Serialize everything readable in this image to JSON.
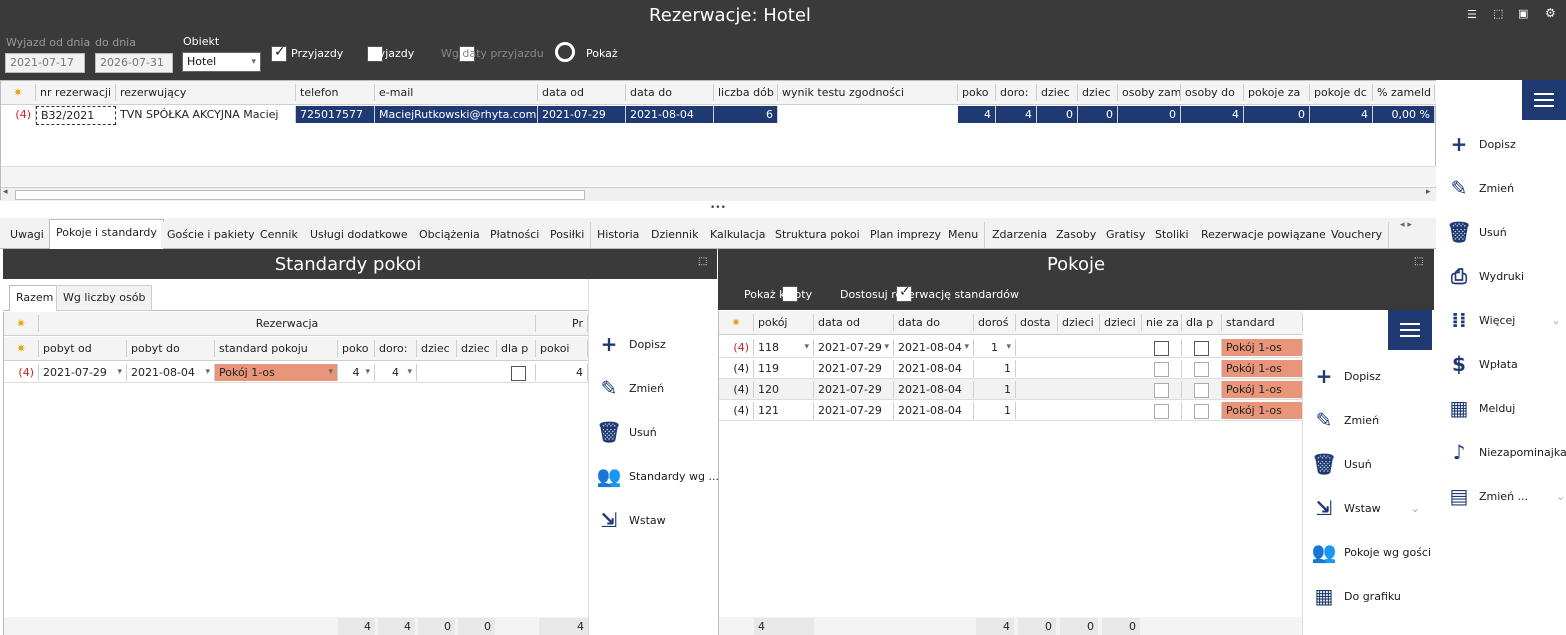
{
  "window": {
    "title": "Rezerwacje: Hotel"
  },
  "top_icons": [
    "list-icon",
    "select-cursor-icon",
    "layout-icon",
    "settings-icon"
  ],
  "filters": {
    "wyjazd_od_label": "Wyjazd od dnia",
    "wyjazd_od_value": "2021-07-17",
    "do_dnia_label": "do dnia",
    "do_dnia_value": "2026-07-31",
    "obiekt_label": "Obiekt",
    "obiekt_value": "Hotel",
    "przyjazdy_label": "Przyjazdy",
    "wyjazdy_label": "Wyjazdy",
    "wg_daty_label": "Wg daty przyjazdu",
    "pokaz_label": "Pokaż"
  },
  "main_table": {
    "columns": [
      "nr rezerwacji",
      "rezerwujący",
      "telefon",
      "e-mail",
      "data od",
      "data do",
      "liczba dób",
      "wynik testu zgodności",
      "poko",
      "doro:",
      "dziec",
      "dziec",
      "osoby zam",
      "osoby do",
      "pokoje za",
      "pokoje dc",
      "% zameld"
    ],
    "row": {
      "count": "(4)",
      "nr": "B32/2021",
      "rezerwujacy": "TVN SPÓŁKA AKCYJNA Maciej",
      "telefon": "725017577",
      "email": "MaciejRutkowski@rhyta.com",
      "data_od": "2021-07-29",
      "data_do": "2021-08-04",
      "doby": "6",
      "wynik": "",
      "pokoje": "4",
      "dorosli": "4",
      "dzieci1": "0",
      "dzieci2": "0",
      "osoby_zam": "0",
      "osoby_do": "4",
      "pokoje_za": "0",
      "pokoje_dc": "4",
      "zameld": "0,00 %"
    }
  },
  "right_sidebar": {
    "actions": [
      "Dopisz",
      "Zmień",
      "Usuń",
      "Wydruki",
      "Więcej",
      "Wpłata",
      "Melduj",
      "Niezapominajka",
      "Zmień ..."
    ]
  },
  "tabs": [
    "Uwagi",
    "Pokoje i standardy",
    "Goście i pakiety",
    "Cennik",
    "Usługi dodatkowe",
    "Obciążenia",
    "Płatności",
    "Posiłki",
    "Historia",
    "Dziennik",
    "Kalkulacja",
    "Struktura pokoi",
    "Plan imprezy",
    "Menu",
    "Zdarzenia",
    "Zasoby",
    "Gratisy",
    "Stoliki",
    "Rezerwacje powiązane",
    "Vouchery"
  ],
  "standardy": {
    "title": "Standardy pokoi",
    "subtabs": [
      "Razem",
      "Wg liczby osób"
    ],
    "group_header": "Rezerwacja",
    "group_header2": "Pr",
    "columns": [
      "pobyt od",
      "pobyt do",
      "standard pokoju",
      "poko",
      "doro:",
      "dziec",
      "dziec",
      "dla p",
      "pokoi"
    ],
    "row": {
      "count": "(4)",
      "od": "2021-07-29",
      "do": "2021-08-04",
      "standard": "Pokój 1-os",
      "pokoje": "4",
      "dorosli": "4",
      "pokoi": "4"
    },
    "sums": [
      "4",
      "4",
      "0",
      "0",
      "4"
    ],
    "actions": [
      "Dopisz",
      "Zmień",
      "Usuń",
      "Standardy wg ...",
      "Wstaw"
    ]
  },
  "pokoje": {
    "title": "Pokoje",
    "pokaz_kwoty": "Pokaż kwoty",
    "dostosuj": "Dostosuj rezerwację standardów",
    "columns": [
      "pokój",
      "data od",
      "data do",
      "doroś",
      "dosta",
      "dzieci",
      "dzieci",
      "nie za",
      "dla p",
      "standard"
    ],
    "rows": [
      {
        "count": "(4)",
        "pokoj": "118",
        "od": "2021-07-29",
        "do": "2021-08-04",
        "dorosli": "1",
        "standard": "Pokój 1-os"
      },
      {
        "count": "(4)",
        "pokoj": "119",
        "od": "2021-07-29",
        "do": "2021-08-04",
        "dorosli": "1",
        "standard": "Pokój 1-os"
      },
      {
        "count": "(4)",
        "pokoj": "120",
        "od": "2021-07-29",
        "do": "2021-08-04",
        "dorosli": "1",
        "standard": "Pokój 1-os"
      },
      {
        "count": "(4)",
        "pokoj": "121",
        "od": "2021-07-29",
        "do": "2021-08-04",
        "dorosli": "1",
        "standard": "Pokój 1-os"
      }
    ],
    "sums": [
      "4",
      "4",
      "0",
      "0",
      "0"
    ],
    "actions": [
      "Dopisz",
      "Zmień",
      "Usuń",
      "Wstaw",
      "Pokoje wg gości",
      "Do grafiku"
    ]
  },
  "colors": {
    "header": "#3a3a3a",
    "accent": "#1f3a72",
    "standard_bg": "#e8957a",
    "count_red": "#cc2222"
  }
}
